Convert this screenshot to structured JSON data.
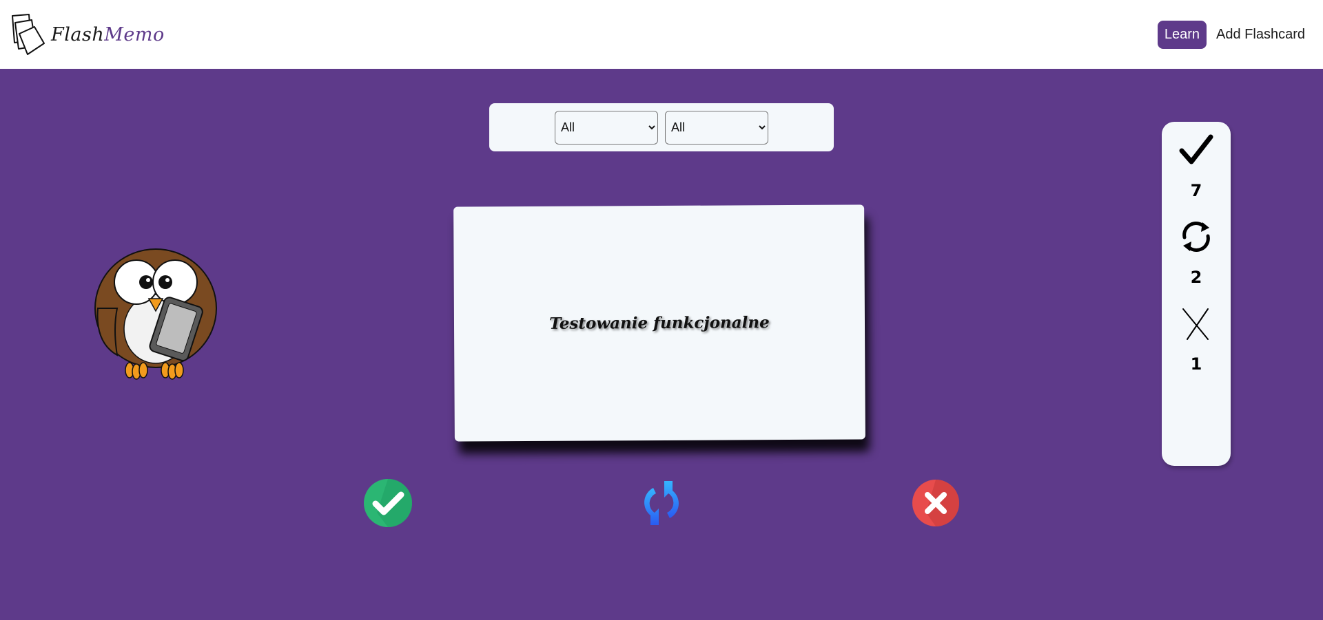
{
  "header": {
    "logo_text_main": "Flash",
    "logo_text_accent": "Memo",
    "nav": {
      "learn_label": "Learn",
      "add_label": "Add Flashcard"
    }
  },
  "filters": {
    "first_selected": "All",
    "second_selected": "All"
  },
  "card": {
    "text": "Testowanie funkcjonalne"
  },
  "stats": {
    "correct_count": "7",
    "repeat_count": "2",
    "wrong_count": "1"
  },
  "colors": {
    "brand": "#5e3a8a",
    "card_bg": "#f4f8fb",
    "correct": "#2bb673",
    "repeat": "#2f7df6",
    "wrong": "#e84c4c"
  },
  "icons": {
    "logo": "cards-icon",
    "mascot": "owl-with-tablet",
    "correct": "check-circle-icon",
    "repeat": "refresh-icon",
    "wrong": "x-circle-icon"
  }
}
